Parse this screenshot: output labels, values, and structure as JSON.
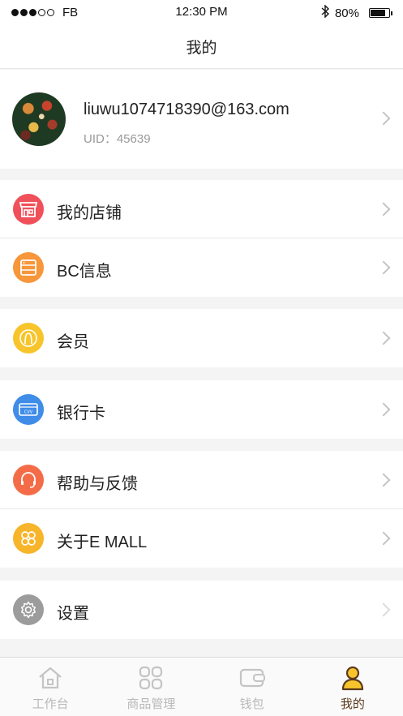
{
  "status_bar": {
    "carrier": "FB",
    "time": "12:30 PM",
    "battery": "80%",
    "battery_level": 0.8,
    "signal_bars_filled": 3,
    "signal_bars_total": 5
  },
  "header": {
    "title": "我的"
  },
  "profile": {
    "email": "liuwu1074718390@163.com",
    "uid": "UID：45639"
  },
  "menu": {
    "store": {
      "label": "我的店铺",
      "icon": "store-icon",
      "color": "#f0505a"
    },
    "bc_info": {
      "label": "BC信息",
      "icon": "bc-info-icon",
      "color": "#f7963a"
    },
    "member": {
      "label": "会员",
      "icon": "member-icon",
      "color": "#f7c52b"
    },
    "bank_card": {
      "label": "银行卡",
      "icon": "bank-card-icon",
      "color": "#3f8de8"
    },
    "help": {
      "label": "帮助与反馈",
      "icon": "headset-icon",
      "color": "#f46c47"
    },
    "about": {
      "label": "关于E MALL",
      "icon": "about-icon",
      "color": "#f7b52b"
    },
    "settings": {
      "label": "设置",
      "icon": "gear-icon",
      "color": "#9c9c9c"
    }
  },
  "tabbar": {
    "workbench": "工作台",
    "products": "商品管理",
    "wallet": "钱包",
    "mine": "我的",
    "active": "mine",
    "active_color": "#5b3a1e",
    "inactive_color": "#b8b8b8"
  }
}
